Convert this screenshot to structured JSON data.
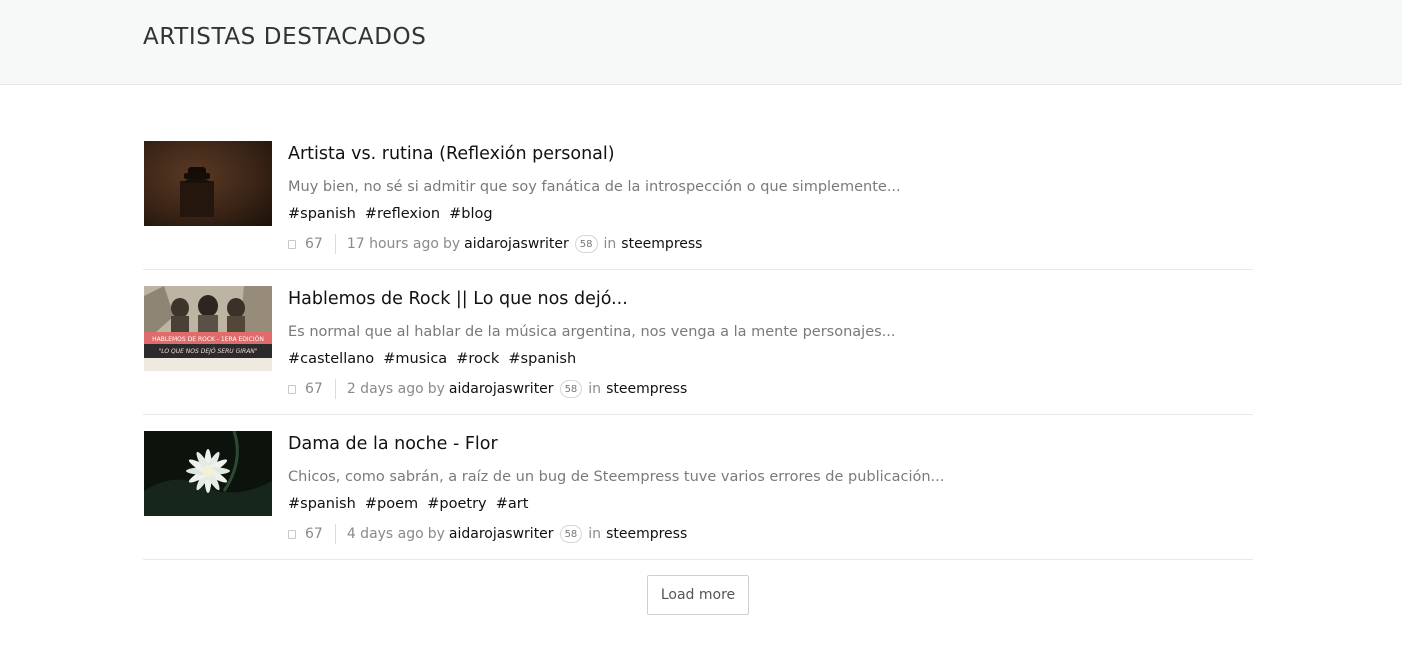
{
  "header": {
    "title": "ARTISTAS DESTACADOS"
  },
  "posts": [
    {
      "title": "Artista vs. rutina (Reflexión personal)",
      "excerpt": "Muy bien, no sé si admitir que soy fanática de la introspección o que simplemente...",
      "tags": [
        "#spanish",
        "#reflexion",
        "#blog"
      ],
      "votes": "67",
      "time": "17 hours ago",
      "by": "by",
      "author": "aidarojaswriter",
      "reputation": "58",
      "in": "in",
      "community": "steempress",
      "thumb_icon": "telephone-photo"
    },
    {
      "title": "Hablemos de Rock || Lo que nos dejó...",
      "excerpt": "Es normal que al hablar de la música argentina, nos venga a la mente personajes...",
      "tags": [
        "#castellano",
        "#musica",
        "#rock",
        "#spanish"
      ],
      "votes": "67",
      "time": "2 days ago",
      "by": "by",
      "author": "aidarojaswriter",
      "reputation": "58",
      "in": "in",
      "community": "steempress",
      "thumb_icon": "band-photo",
      "thumb_caption_1": "HABLEMOS DE ROCK - 1ERA EDICIÓN",
      "thumb_caption_2": "\"LO QUE NOS DEJÓ SERU GIRAN\""
    },
    {
      "title": "Dama de la noche - Flor",
      "excerpt": "Chicos, como sabrán, a raíz de un bug de Steempress tuve varios errores de publicación...",
      "tags": [
        "#spanish",
        "#poem",
        "#poetry",
        "#art"
      ],
      "votes": "67",
      "time": "4 days ago",
      "by": "by",
      "author": "aidarojaswriter",
      "reputation": "58",
      "in": "in",
      "community": "steempress",
      "thumb_icon": "flower-photo"
    }
  ],
  "load_more_label": "Load more",
  "colors": {
    "header_bg": "#f7f8f8",
    "excerpt": "#7a7a7a",
    "caption_red": "#e05a5a"
  }
}
